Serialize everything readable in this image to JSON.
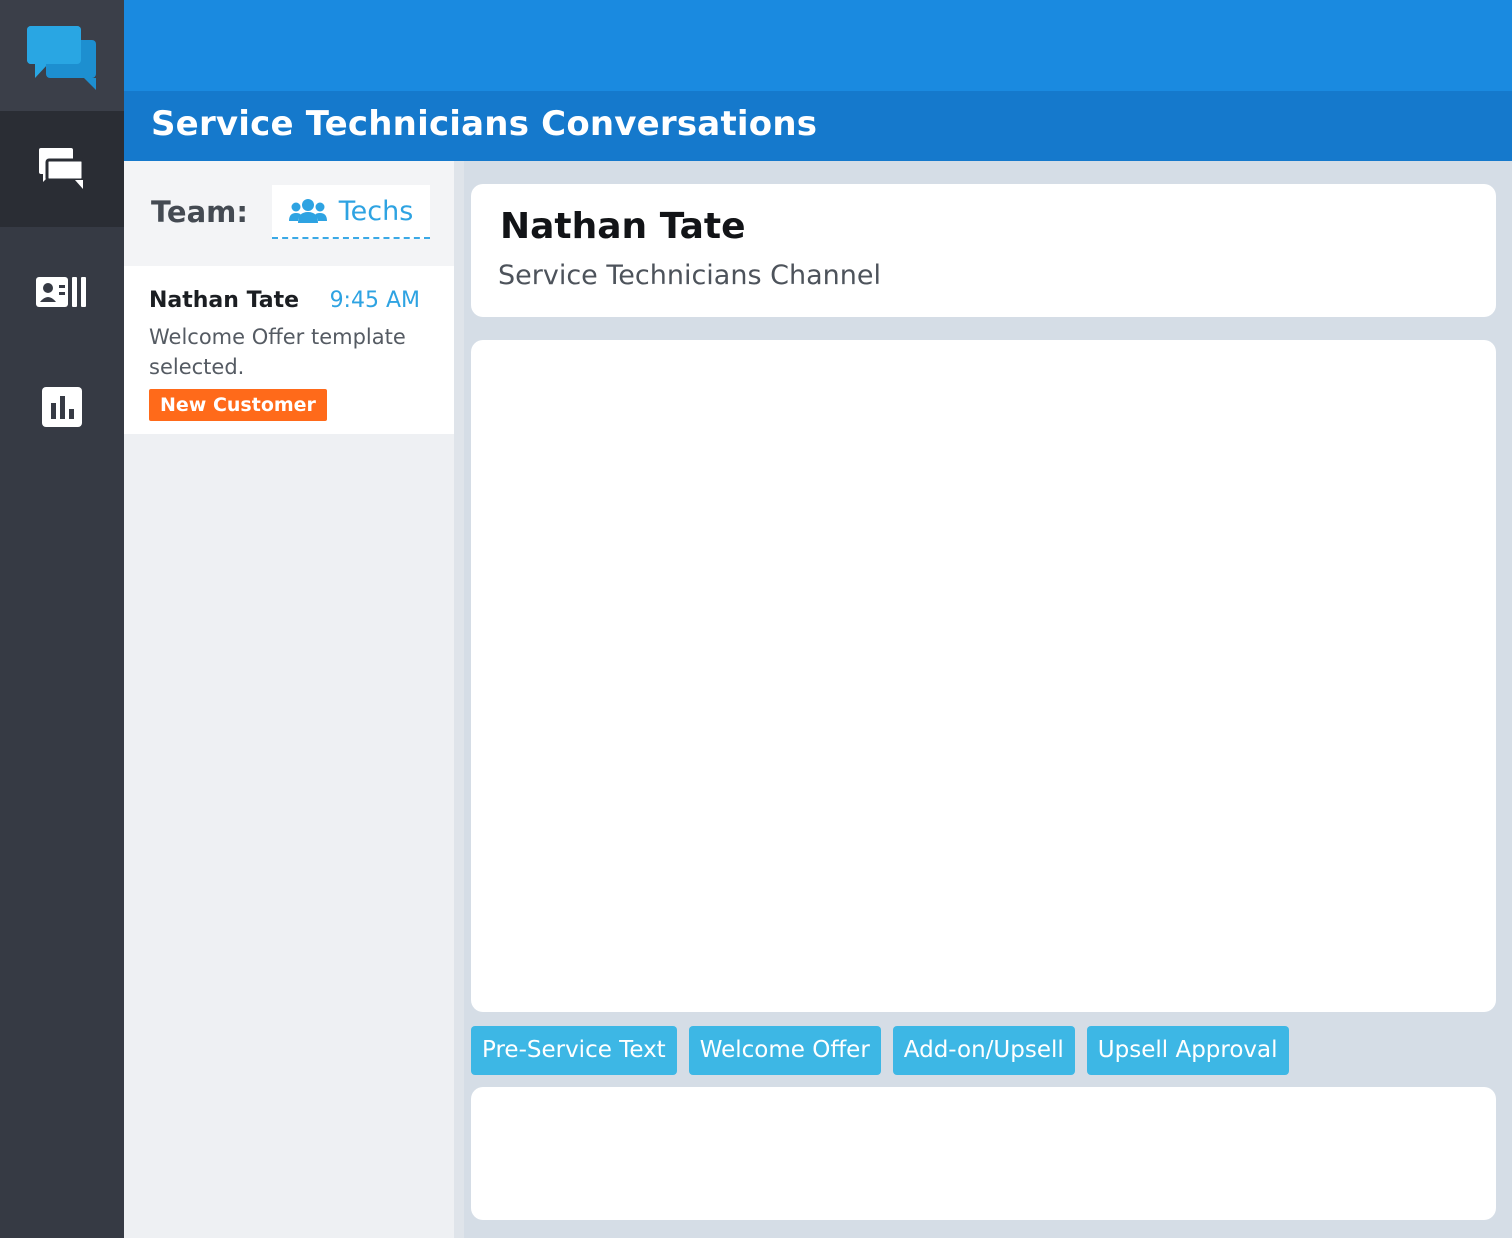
{
  "app": {
    "page_title": "Service Technicians Conversations"
  },
  "sidebar": {
    "items": [
      {
        "icon": "chat-logo-icon",
        "color": "#29a6e3"
      },
      {
        "icon": "conversations-icon",
        "active": true
      },
      {
        "icon": "contacts-icon"
      },
      {
        "icon": "reports-icon"
      }
    ]
  },
  "team": {
    "label": "Team:",
    "selected": "Techs",
    "icon": "users-icon"
  },
  "conversations": [
    {
      "name": "Nathan Tate",
      "time": "9:45 AM",
      "preview": "Welcome Offer template selected.",
      "tag": "New Customer",
      "tag_color": "#ff6a1a"
    }
  ],
  "contact": {
    "name": "Nathan Tate",
    "channel": "Service Technicians Channel"
  },
  "templates": [
    "Pre-Service Text",
    "Welcome Offer",
    "Add-on/Upsell",
    "Upsell Approval"
  ],
  "colors": {
    "header": "#1a8ae0",
    "title_bar": "#1579cc",
    "accent": "#2ea3e2",
    "template_button": "#3db7e5",
    "rail": "#363a44"
  }
}
